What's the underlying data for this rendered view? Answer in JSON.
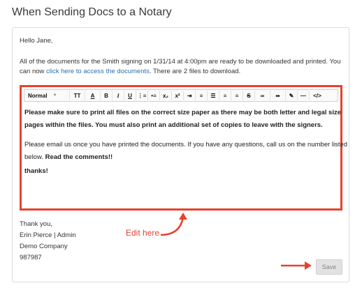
{
  "page": {
    "title": "When Sending Docs to a Notary"
  },
  "email": {
    "greeting": "Hello Jane,",
    "line1": "All of the documents for the Smith signing on 1/31/14 at 4:00pm are ready to be downloaded and printed. You",
    "line2_prefix": "can now ",
    "line2_link": "click here to access the documents",
    "line2_suffix": ". There are 2 files to download."
  },
  "editor": {
    "toolbar": {
      "format_label": "Normal",
      "buttons": [
        {
          "name": "font-size-icon",
          "glyph": "TT"
        },
        {
          "name": "text-color-icon",
          "glyph": "A"
        },
        {
          "name": "bold-icon",
          "glyph": "B"
        },
        {
          "name": "italic-icon",
          "glyph": "I"
        },
        {
          "name": "underline-icon",
          "glyph": "U"
        },
        {
          "name": "ordered-list-icon",
          "glyph": "⋮≡"
        },
        {
          "name": "unordered-list-icon",
          "glyph": "•≡"
        },
        {
          "name": "subscript-icon",
          "glyph": "x₂"
        },
        {
          "name": "superscript-icon",
          "glyph": "x²"
        },
        {
          "name": "indent-icon",
          "glyph": "⇥"
        },
        {
          "name": "align-left-icon",
          "glyph": "≡"
        },
        {
          "name": "align-left-alt-icon",
          "glyph": "☰"
        },
        {
          "name": "align-center-icon",
          "glyph": "≡"
        },
        {
          "name": "align-right-icon",
          "glyph": "≡"
        },
        {
          "name": "strikethrough-icon",
          "glyph": "S"
        },
        {
          "name": "link-icon",
          "glyph": "∞"
        },
        {
          "name": "unlink-icon",
          "glyph": "∞"
        },
        {
          "name": "clear-format-icon",
          "glyph": "✎"
        },
        {
          "name": "horizontal-rule-icon",
          "glyph": "—"
        },
        {
          "name": "code-view-icon",
          "glyph": "</>"
        }
      ]
    },
    "para1_line1": "Please make sure to print all files on the correct size paper as there may be both letter and legal size",
    "para1_line2": "pages within the files. You must also print an additional set of copies to leave with the signers.",
    "para2_line1": "Please email us once you have printed the documents. If you have any questions, call us on the number listed",
    "para2_line2_prefix": "below. ",
    "para2_line2_bold": "Read the comments!!",
    "para3": "thanks!"
  },
  "signature": {
    "line1": "Thank you,",
    "line2": "Erin Pierce | Admin",
    "line3": "Demo Company",
    "line4": "987987"
  },
  "annotation": {
    "edit_here": "Edit here"
  },
  "actions": {
    "save_label": "Save"
  },
  "colors": {
    "accent": "#e8412c",
    "link": "#2a6fb0"
  }
}
